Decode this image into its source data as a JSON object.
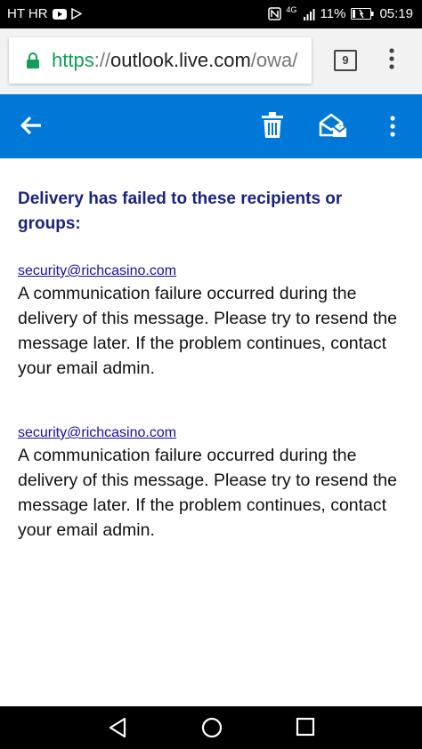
{
  "status_bar": {
    "carrier": "HT HR",
    "network": "4G",
    "battery": "11%",
    "time": "05:19"
  },
  "browser": {
    "url_scheme": "https",
    "url_sep": "://",
    "url_host": "outlook.live.com",
    "url_path": "/owa/",
    "tab_count": "9"
  },
  "app_bar": {
    "accent": "#0078d7"
  },
  "content": {
    "heading": "Delivery has failed to these recipients or groups:",
    "failures": [
      {
        "email": "security@richcasino.com",
        "message": "A communication failure occurred during the delivery of this message. Please try to resend the message later. If the problem continues, contact your email admin."
      },
      {
        "email": "security@richcasino.com",
        "message": "A communication failure occurred during the delivery of this message. Please try to resend the message later. If the problem continues, contact your email admin."
      }
    ]
  }
}
